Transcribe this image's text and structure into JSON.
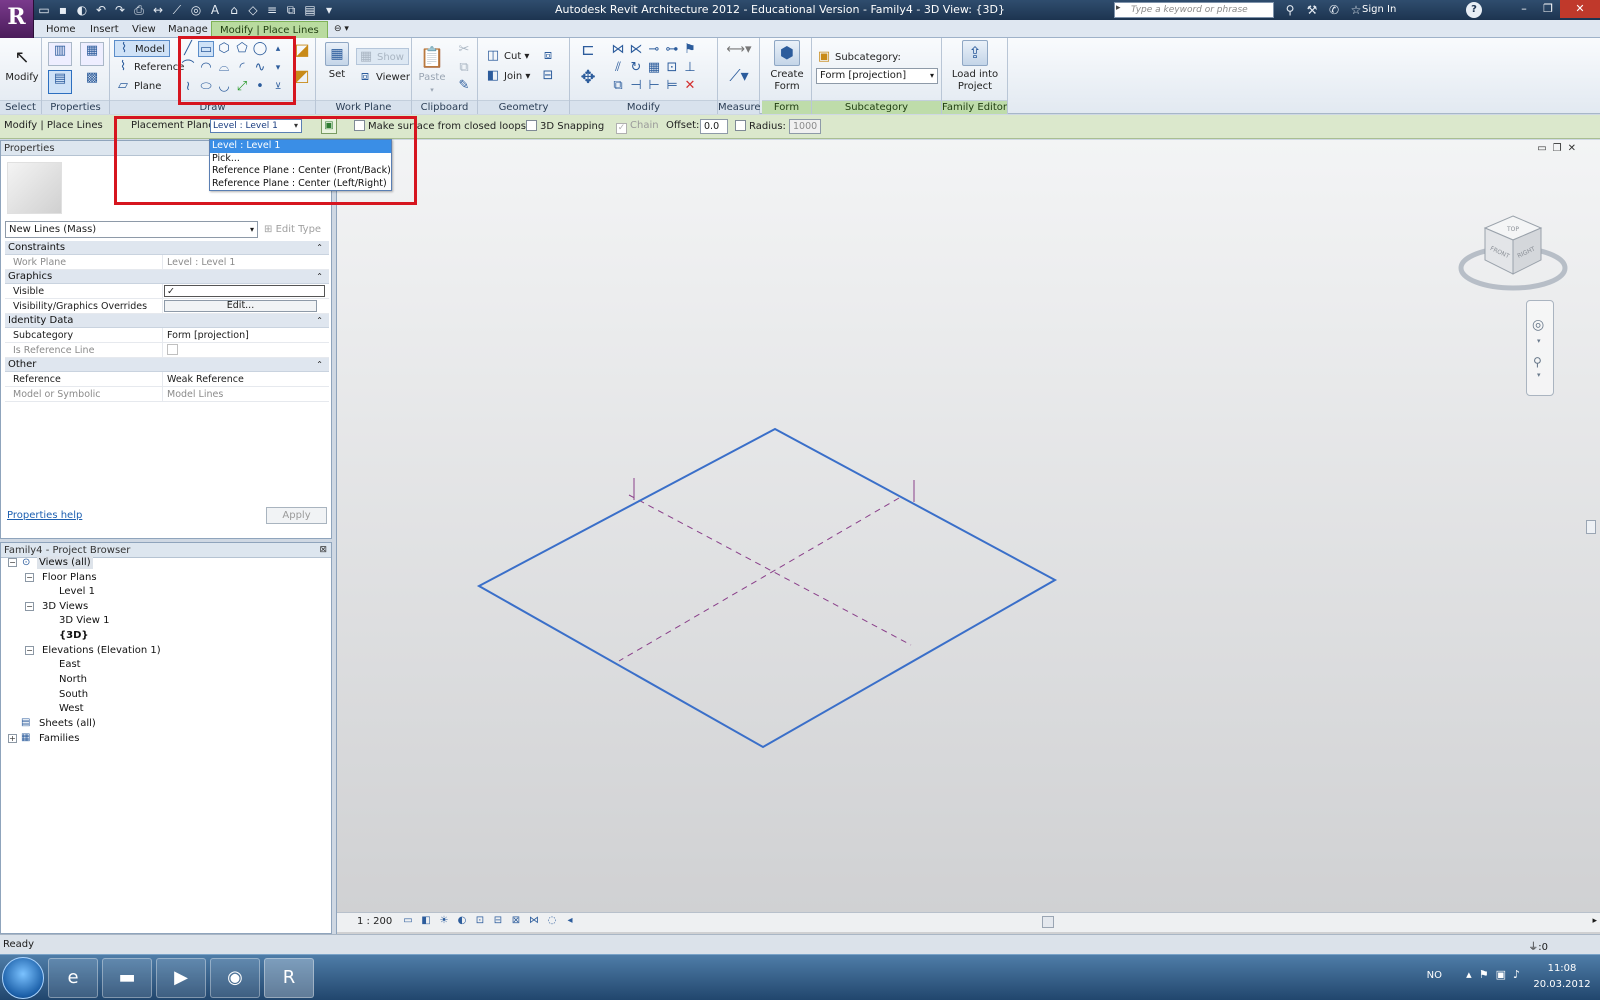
{
  "window": {
    "title": "Autodesk Revit Architecture 2012 - Educational Version -    Family4 - 3D View: {3D}",
    "search_placeholder": "Type a keyword or phrase",
    "sign_in": "Sign In",
    "help": "?"
  },
  "tabs": [
    "Home",
    "Insert",
    "View",
    "Manage",
    "Modify | Place Lines"
  ],
  "ribbon": {
    "select": {
      "modify": "Modify",
      "label": "Select"
    },
    "properties": {
      "label": "Properties"
    },
    "draw": {
      "model": "Model",
      "reference": "Reference",
      "plane": "Plane",
      "label": "Draw"
    },
    "work_plane": {
      "set": "Set",
      "show": "Show",
      "viewer": "Viewer",
      "label": "Work Plane"
    },
    "clipboard": {
      "paste": "Paste",
      "label": "Clipboard"
    },
    "geometry": {
      "cut": "Cut",
      "join": "Join",
      "label": "Geometry"
    },
    "modify": {
      "label": "Modify"
    },
    "measure": {
      "label": "Measure"
    },
    "form": {
      "create_form_1": "Create",
      "create_form_2": "Form",
      "label": "Form"
    },
    "subcategory": {
      "title": "Subcategory:",
      "value": "Form [projection]",
      "label": "Subcategory"
    },
    "family_editor": {
      "load_1": "Load into",
      "load_2": "Project",
      "label": "Family Editor"
    }
  },
  "options_bar": {
    "context": "Modify | Place Lines",
    "placement_plane_label": "Placement Plane:",
    "placement_plane_value": "Level : Level 1",
    "make_surface": "Make surface from closed loops",
    "snapping": "3D Snapping",
    "chain": "Chain",
    "offset_label": "Offset:",
    "offset_value": "0.0",
    "radius_label": "Radius:",
    "radius_value": "1000"
  },
  "dropdown": {
    "items": [
      "Level : Level 1",
      "Pick...",
      "Reference Plane : Center (Front/Back)",
      "Reference Plane : Center (Left/Right)"
    ],
    "selected_index": 0
  },
  "properties": {
    "title": "Properties",
    "type": "New Lines (Mass)",
    "edit_type": "Edit Type",
    "groups": {
      "constraints": "Constraints",
      "graphics": "Graphics",
      "identity": "Identity Data",
      "other": "Other"
    },
    "rows": {
      "work_plane": {
        "k": "Work Plane",
        "v": "Level : Level 1"
      },
      "visible": {
        "k": "Visible",
        "v": "✓"
      },
      "vg_overrides": {
        "k": "Visibility/Graphics Overrides",
        "v": "Edit..."
      },
      "subcategory": {
        "k": "Subcategory",
        "v": "Form [projection]"
      },
      "is_reference_line": {
        "k": "Is Reference Line",
        "v": ""
      },
      "reference": {
        "k": "Reference",
        "v": "Weak Reference"
      },
      "model_or_symbolic": {
        "k": "Model or Symbolic",
        "v": "Model Lines"
      }
    },
    "help": "Properties help",
    "apply": "Apply"
  },
  "browser": {
    "title": "Family4 - Project Browser",
    "views_all": "Views (all)",
    "floor_plans": "Floor Plans",
    "level1": "Level 1",
    "views3d": "3D Views",
    "view3d1": "3D View 1",
    "view3d": "{3D}",
    "elevations": "Elevations (Elevation 1)",
    "east": "East",
    "north": "North",
    "south": "South",
    "west": "West",
    "sheets": "Sheets (all)",
    "families": "Families"
  },
  "viewport": {
    "scale": "1 : 200",
    "viewcube_top": "TOP",
    "viewcube_front": "FRONT",
    "viewcube_right": "RIGHT",
    "line_color": "#3a6fc9",
    "ref_color": "#8a3f8a"
  },
  "status": {
    "text": "Ready",
    "filter": ":0"
  },
  "taskbar": {
    "lang": "NO",
    "time": "11:08",
    "date": "20.03.2012"
  },
  "colors": {
    "accent_green": "#b9db9f",
    "highlight_red": "#d6151f",
    "selection_blue": "#3a8ee6"
  }
}
